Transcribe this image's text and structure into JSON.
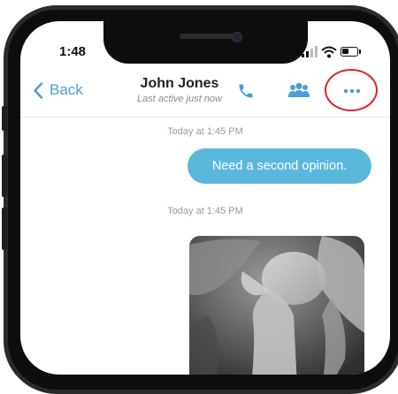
{
  "status_bar": {
    "time": "1:48"
  },
  "header": {
    "back_label": "Back",
    "contact_name": "John Jones",
    "last_active": "Last active just now"
  },
  "icons": {
    "back": "chevron-left-icon",
    "call": "phone-icon",
    "participants": "group-icon",
    "more": "more-dots-icon"
  },
  "messages": [
    {
      "timestamp": "Today at 1:45 PM",
      "type": "text",
      "text": "Need a second opinion."
    },
    {
      "timestamp": "Today at 1:45 PM",
      "type": "image",
      "image_subject": "x-ray image"
    }
  ],
  "colors": {
    "accent": "#4a9fd4",
    "bubble": "#5bb7dc",
    "highlight": "#e0202a"
  }
}
